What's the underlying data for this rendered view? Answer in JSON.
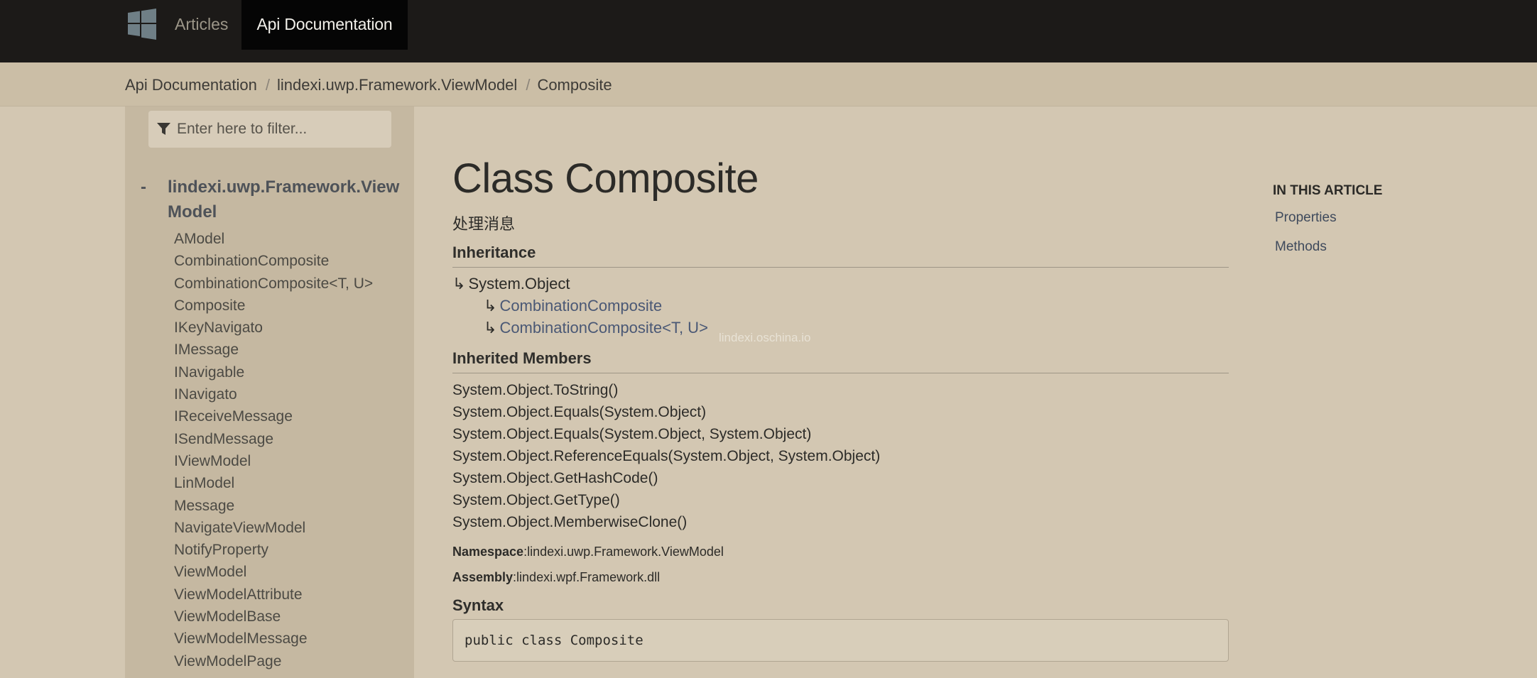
{
  "nav": {
    "logo_icon": "windows-logo-icon",
    "articles_label": "Articles",
    "api_label": "Api Documentation"
  },
  "breadcrumb": {
    "items": [
      "Api Documentation",
      "lindexi.uwp.Framework.ViewModel",
      "Composite"
    ],
    "separator": "/"
  },
  "sidebar": {
    "filter_icon": "filter-icon",
    "filter_placeholder": "Enter here to filter...",
    "root_toggle": "-",
    "root_label_line1": "lindexi.uwp.Framework.View",
    "root_label_line2": "Model",
    "items": [
      "AModel",
      "CombinationComposite",
      "CombinationComposite<T, U>",
      "Composite",
      "IKeyNavigato",
      "IMessage",
      "INavigable",
      "INavigato",
      "IReceiveMessage",
      "ISendMessage",
      "IViewModel",
      "LinModel",
      "Message",
      "NavigateViewModel",
      "NotifyProperty",
      "ViewModel",
      "ViewModelAttribute",
      "ViewModelBase",
      "ViewModelMessage",
      "ViewModelPage"
    ]
  },
  "main": {
    "title": "Class Composite",
    "summary": "处理消息",
    "inheritance_heading": "Inheritance",
    "inheritance_arrow": "↳",
    "inheritance": [
      "System.Object",
      "CombinationComposite",
      "CombinationComposite<T, U>"
    ],
    "inherited_heading": "Inherited Members",
    "inherited_members": [
      "System.Object.ToString()",
      "System.Object.Equals(System.Object)",
      "System.Object.Equals(System.Object, System.Object)",
      "System.Object.ReferenceEquals(System.Object, System.Object)",
      "System.Object.GetHashCode()",
      "System.Object.GetType()",
      "System.Object.MemberwiseClone()"
    ],
    "namespace_label": "Namespace",
    "namespace_value": ":lindexi.uwp.Framework.ViewModel",
    "assembly_label": "Assembly",
    "assembly_value": ":lindexi.wpf.Framework.dll",
    "syntax_heading": "Syntax",
    "code": "public class Composite",
    "watermark": "lindexi.oschina.io"
  },
  "aside": {
    "title": "IN THIS ARTICLE",
    "links": [
      "Properties",
      "Methods"
    ]
  },
  "colors": {
    "topbar": "#1c1a18",
    "active_tab": "#050505",
    "page_bg": "#d3c7b2",
    "sidebar_bg": "#c5b8a1",
    "link": "#4a5875"
  }
}
